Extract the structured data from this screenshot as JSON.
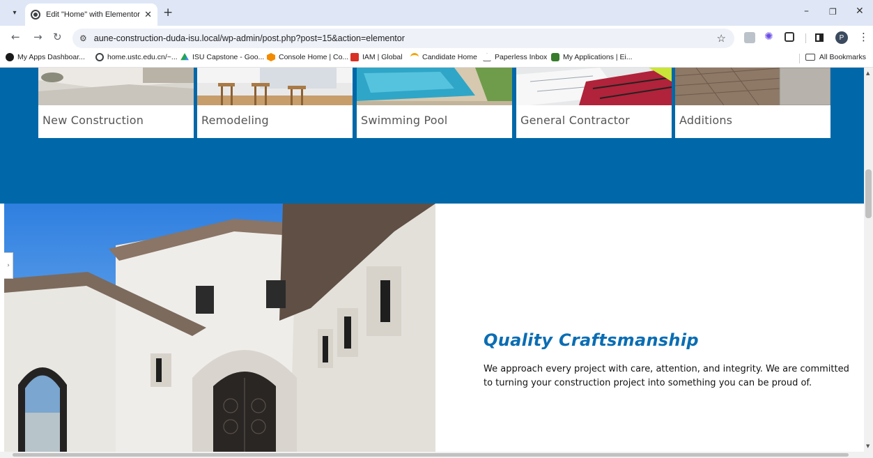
{
  "browser": {
    "tab_title": "Edit \"Home\" with Elementor",
    "url": "aune-construction-duda-isu.local/wp-admin/post.php?post=15&action=elementor",
    "profile_initial": "P",
    "bookmarks": [
      {
        "label": "My Apps Dashboar...",
        "icon": "circle-dark-icon",
        "color": "#1a1a1a"
      },
      {
        "label": "home.ustc.edu.cn/~...",
        "icon": "globe-icon",
        "color": "#3c4043"
      },
      {
        "label": "ISU Capstone - Goo...",
        "icon": "google-drive-icon",
        "color": "#1fa463"
      },
      {
        "label": "Console Home | Co...",
        "icon": "cube-icon",
        "color": "#f28b00"
      },
      {
        "label": "IAM | Global",
        "icon": "iam-icon",
        "color": "#d93025"
      },
      {
        "label": "Candidate Home",
        "icon": "workday-icon",
        "color": "#f4a300"
      },
      {
        "label": "Paperless Inbox",
        "icon": "paperless-icon",
        "color": "#5f6368"
      },
      {
        "label": "My Applications | Ei...",
        "icon": "deere-icon",
        "color": "#367c2b"
      }
    ],
    "all_bookmarks": "All Bookmarks"
  },
  "page": {
    "brand_blue": "#0068a8",
    "services": [
      {
        "label": "New Construction"
      },
      {
        "label": "Remodeling"
      },
      {
        "label": "Swimming Pool"
      },
      {
        "label": "General Contractor"
      },
      {
        "label": "Additions"
      }
    ],
    "feature": {
      "heading": "Quality Craftsmanship",
      "paragraph": "We approach every project with care, attention, and integrity. We are committed to turning your construction project into something you can be proud of."
    }
  }
}
